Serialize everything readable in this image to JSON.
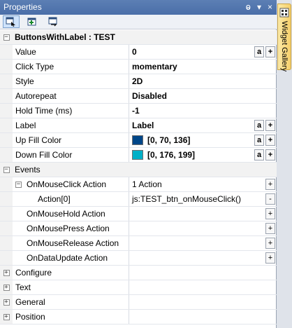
{
  "panel": {
    "title": "Properties",
    "pin_glyph": "ⱺ",
    "dropdown_glyph": "▾",
    "close_glyph": "×"
  },
  "toolbar": {
    "buttons": [
      {
        "name": "properties-view-icon"
      },
      {
        "name": "add-property-icon"
      },
      {
        "name": "events-view-icon"
      }
    ]
  },
  "grid": {
    "object_header": "ButtonsWithLabel : TEST",
    "rows": {
      "value": {
        "label": "Value",
        "value": "0"
      },
      "click_type": {
        "label": "Click Type",
        "value": "momentary"
      },
      "style": {
        "label": "Style",
        "value": "2D"
      },
      "autorepeat": {
        "label": "Autorepeat",
        "value": "Disabled"
      },
      "hold_time": {
        "label": "Hold Time (ms)",
        "value": "-1"
      },
      "label": {
        "label": "Label",
        "value": "Label"
      },
      "up_fill_color": {
        "label": "Up Fill Color",
        "value": "[0, 70, 136]",
        "swatch": "#004688"
      },
      "down_fill_color": {
        "label": "Down Fill Color",
        "value": "[0, 176, 199]",
        "swatch": "#00b0c7"
      }
    },
    "events": {
      "label": "Events",
      "on_mouse_click": {
        "label": "OnMouseClick Action",
        "value": "1 Action"
      },
      "action0": {
        "label": "Action[0]",
        "value": "js:TEST_btn_onMouseClick()"
      },
      "on_mouse_hold": {
        "label": "OnMouseHold Action"
      },
      "on_mouse_press": {
        "label": "OnMousePress Action"
      },
      "on_mouse_release": {
        "label": "OnMouseRelease Action"
      },
      "on_data_update": {
        "label": "OnDataUpdate Action"
      }
    },
    "sections": {
      "configure": "Configure",
      "text": "Text",
      "general": "General",
      "position": "Position"
    },
    "button_labels": {
      "a": "a",
      "plus": "+",
      "minus": "-"
    },
    "expand_glyph": "+",
    "collapse_glyph": "−"
  },
  "sidebar": {
    "tab_label": "Widget Gallery"
  }
}
